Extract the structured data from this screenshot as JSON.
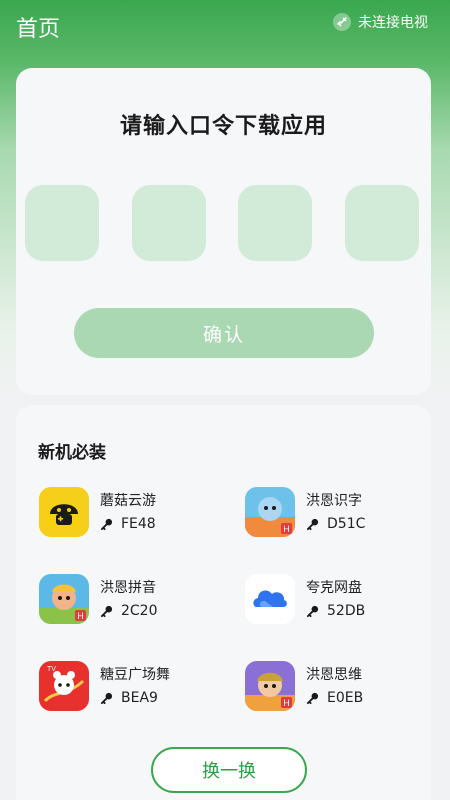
{
  "header": {
    "title": "首页",
    "tv_status": "未连接电视"
  },
  "code_card": {
    "title": "请输入口令下载应用",
    "confirm_label": "确认"
  },
  "apps_section": {
    "title": "新机必装",
    "apps": [
      {
        "name": "蘑菇云游",
        "code": "FE48",
        "icon": "mushroom-gamepad-icon"
      },
      {
        "name": "洪恩识字",
        "code": "D51C",
        "icon": "hongen-characters-icon"
      },
      {
        "name": "洪恩拼音",
        "code": "2C20",
        "icon": "hongen-pinyin-icon"
      },
      {
        "name": "夸克网盘",
        "code": "52DB",
        "icon": "quark-cloud-icon"
      },
      {
        "name": "糖豆广场舞",
        "code": "BEA9",
        "icon": "tangdou-dance-icon"
      },
      {
        "name": "洪恩思维",
        "code": "E0EB",
        "icon": "hongen-thinking-icon"
      }
    ],
    "swap_label": "换一换"
  },
  "colors": {
    "brand_green": "#3aa84f",
    "code_box": "#d2ead8",
    "confirm_bg": "#a9d8b3"
  }
}
